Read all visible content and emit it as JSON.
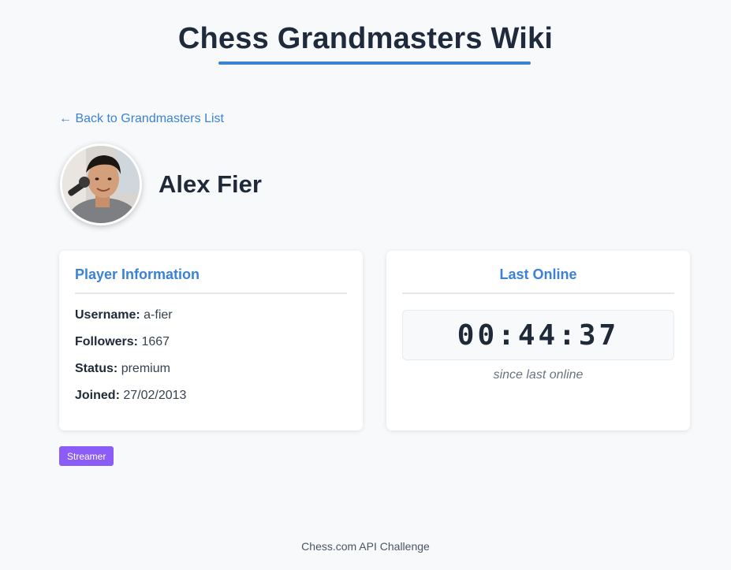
{
  "header": {
    "title": "Chess Grandmasters Wiki"
  },
  "nav": {
    "back_link": "← Back to Grandmasters List"
  },
  "player": {
    "name": "Alex Fier",
    "avatar_alt": "Alex Fier avatar"
  },
  "player_info": {
    "title": "Player Information",
    "rows": [
      {
        "key": "Username:",
        "value": "a-fier"
      },
      {
        "key": "Followers:",
        "value": "1667"
      },
      {
        "key": "Status:",
        "value": "premium"
      },
      {
        "key": "Joined:",
        "value": "27/02/2013"
      }
    ]
  },
  "last_online": {
    "title": "Last Online",
    "timer": "00:44:37",
    "caption": "since last online"
  },
  "badges": [
    {
      "label": "Streamer",
      "color": "#8b5cf6"
    }
  ],
  "footer": {
    "text": "Chess.com API Challenge"
  },
  "colors": {
    "accent": "#3b82d6",
    "background": "#f7f9fb",
    "badge_purple": "#8b5cf6"
  }
}
